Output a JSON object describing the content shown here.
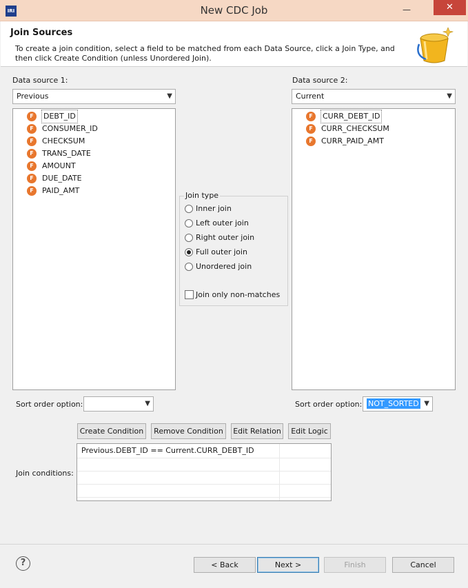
{
  "window": {
    "title": "New CDC Job",
    "app_icon": "IRI",
    "minimize_glyph": "—",
    "close_glyph": "✕"
  },
  "header": {
    "title": "Join Sources",
    "description": "To create a join condition, select a field to be matched from each Data Source, click a Join Type, and then click Create Condition (unless Unordered Join)."
  },
  "source1": {
    "label": "Data source 1:",
    "selected": "Previous",
    "fields": [
      "DEBT_ID",
      "CONSUMER_ID",
      "CHECKSUM",
      "TRANS_DATE",
      "AMOUNT",
      "DUE_DATE",
      "PAID_AMT"
    ],
    "sort_label": "Sort order option:",
    "sort_value": ""
  },
  "source2": {
    "label": "Data source 2:",
    "selected": "Current",
    "fields": [
      "CURR_DEBT_ID",
      "CURR_CHECKSUM",
      "CURR_PAID_AMT"
    ],
    "sort_label": "Sort order option:",
    "sort_value": "NOT_SORTED"
  },
  "join_type": {
    "label": "Join type",
    "options": [
      "Inner join",
      "Left outer join",
      "Right outer join",
      "Full outer join",
      "Unordered join"
    ],
    "selected": "Full outer join",
    "nonmatch_label": "Join only non-matches",
    "nonmatch_checked": false
  },
  "condition_buttons": {
    "create": "Create Condition",
    "remove": "Remove Condition",
    "edit_relation": "Edit Relation",
    "edit_logic": "Edit Logic"
  },
  "conditions": {
    "label": "Join conditions:",
    "rows": [
      "Previous.DEBT_ID == Current.CURR_DEBT_ID"
    ]
  },
  "footer": {
    "help": "?",
    "back": "< Back",
    "next": "Next >",
    "finish": "Finish",
    "cancel": "Cancel"
  },
  "icons": {
    "field": "field-f-icon",
    "wizard": "bucket-icon",
    "help": "help-icon",
    "dropdown": "chevron-down-icon"
  },
  "colors": {
    "field_icon": "#e8772e",
    "titlebar": "#f6d8c4",
    "close": "#c7453a",
    "selection": "#3399ff"
  }
}
